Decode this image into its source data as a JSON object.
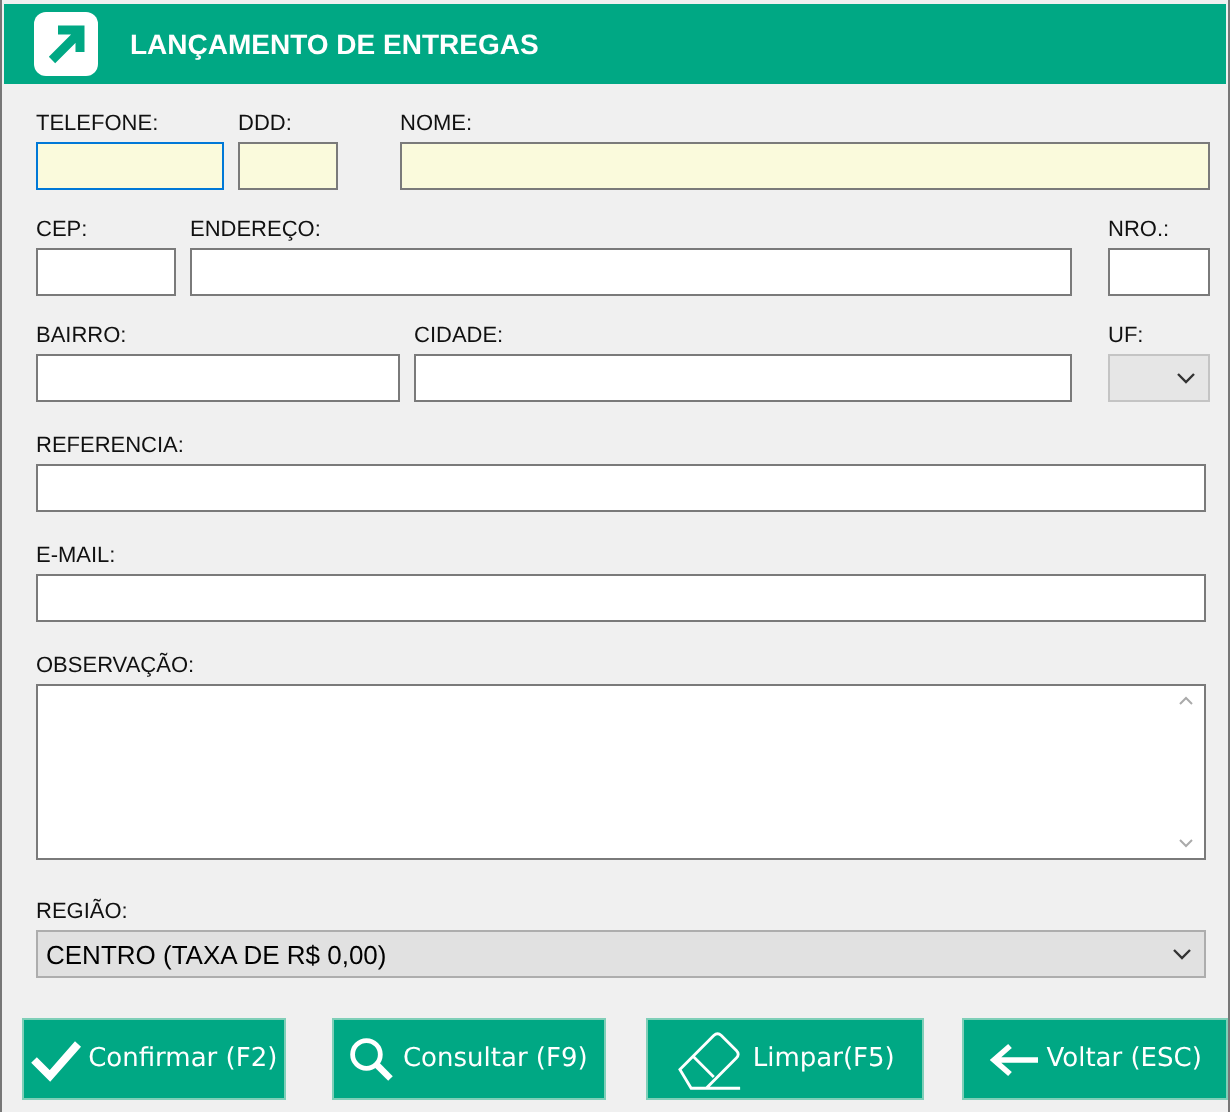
{
  "window": {
    "title": "LANÇAMENTO DE ENTREGAS"
  },
  "rows": [
    [
      {
        "label": "TELEFONE:",
        "kind": "text",
        "highlighted": true,
        "focused": true
      },
      {
        "label": "DDD:",
        "kind": "text",
        "highlighted": true,
        "focused": false
      },
      {
        "label": "NOME:",
        "kind": "text",
        "highlighted": true,
        "focused": false
      }
    ],
    [
      {
        "label": "CEP:",
        "kind": "text",
        "highlighted": false,
        "focused": false
      },
      {
        "label": "ENDEREÇO:",
        "kind": "text",
        "highlighted": false,
        "focused": false
      },
      {
        "label": "NRO.:",
        "kind": "text",
        "highlighted": false,
        "focused": false
      }
    ],
    [
      {
        "label": "BAIRRO:",
        "kind": "text",
        "highlighted": false,
        "focused": false
      },
      {
        "label": "CIDADE:",
        "kind": "text",
        "highlighted": false,
        "focused": false
      },
      {
        "label": "UF:",
        "kind": "select",
        "disabled": true
      }
    ],
    [
      {
        "label": "REFERENCIA:",
        "kind": "text",
        "highlighted": false,
        "focused": false
      }
    ],
    [
      {
        "label": "E-MAIL:",
        "kind": "text",
        "highlighted": false,
        "focused": false
      }
    ],
    [
      {
        "label": "OBSERVAÇÃO:",
        "kind": "textarea"
      }
    ],
    [
      {
        "label": "REGIÃO:",
        "kind": "select",
        "disabled": false,
        "value": "CENTRO (TAXA DE R$ 0,00)"
      }
    ]
  ],
  "buttons": [
    {
      "label": "Confirmar (F2)",
      "kind": "confirm"
    },
    {
      "label": "Consultar (F9)",
      "kind": "search"
    },
    {
      "label": "Limpar(F5)",
      "kind": "clear"
    },
    {
      "label": "Voltar (ESC)",
      "kind": "back"
    }
  ]
}
